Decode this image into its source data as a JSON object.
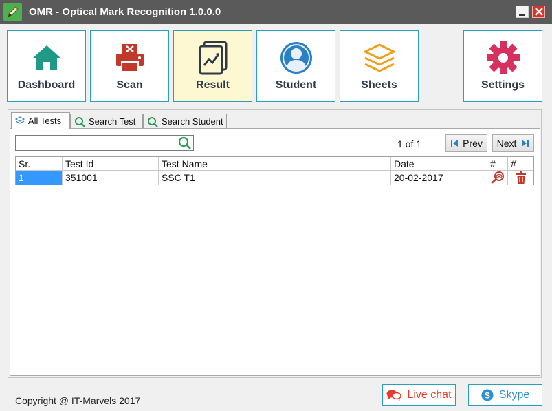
{
  "window": {
    "title": "OMR - Optical Mark Recognition 1.0.0.0"
  },
  "nav": {
    "dashboard": "Dashboard",
    "scan": "Scan",
    "result": "Result",
    "student": "Student",
    "sheets": "Sheets",
    "settings": "Settings"
  },
  "tabs": {
    "all_tests": "All Tests",
    "search_test": "Search Test",
    "search_student": "Search Student"
  },
  "search": {
    "value": "",
    "placeholder": ""
  },
  "pagination": {
    "info": "1 of 1",
    "prev": "Prev",
    "next": "Next"
  },
  "grid": {
    "columns": [
      "Sr.",
      "Test Id",
      "Test Name",
      "Date",
      "#",
      "#"
    ],
    "rows": [
      {
        "sr": "1",
        "test_id": "351001",
        "test_name": "SSC T1",
        "date": "20-02-2017"
      }
    ]
  },
  "footer": {
    "copyright": "Copyright @ IT-Marvels 2017",
    "live_chat": "Live chat",
    "skype": "Skype"
  },
  "colors": {
    "accent_border": "#2aa0b8",
    "active_tab_bg": "#fef8d2",
    "selection": "#3399ff",
    "danger": "#e63b2e"
  }
}
